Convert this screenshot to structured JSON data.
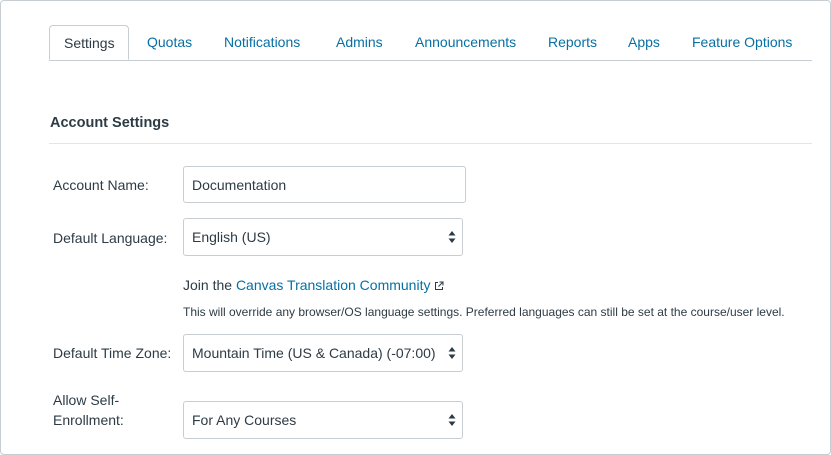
{
  "tabs": [
    {
      "label": "Settings",
      "active": true
    },
    {
      "label": "Quotas"
    },
    {
      "label": "Notifications"
    },
    {
      "label": "Admins"
    },
    {
      "label": "Announcements"
    },
    {
      "label": "Reports"
    },
    {
      "label": "Apps"
    },
    {
      "label": "Feature Options"
    }
  ],
  "section": {
    "title": "Account Settings"
  },
  "account_name": {
    "label": "Account Name:",
    "value": "Documentation"
  },
  "default_language": {
    "label": "Default Language:",
    "value": "English (US)"
  },
  "translation": {
    "prefix": "Join the",
    "link_text": "Canvas Translation Community",
    "help": "This will override any browser/OS language settings. Preferred languages can still be set at the course/user level."
  },
  "time_zone": {
    "label": "Default Time Zone:",
    "value": "Mountain Time (US & Canada) (-07:00)"
  },
  "self_enrollment": {
    "label_line1": "Allow Self-",
    "label_line2": "Enrollment:",
    "value": "For Any Courses"
  },
  "colors": {
    "link": "#0770a3",
    "text": "#2d3b45",
    "border": "#c7cdd1"
  }
}
